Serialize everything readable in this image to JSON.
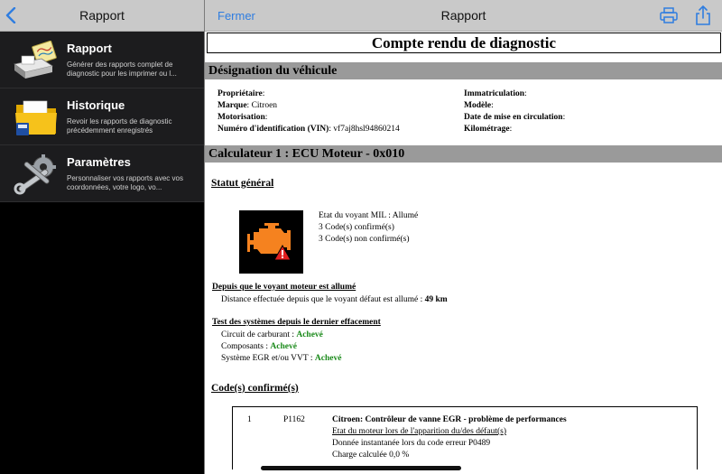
{
  "sidebar": {
    "title": "Rapport",
    "items": [
      {
        "icon": "report-printer-icon",
        "title": "Rapport",
        "description": "Générer des rapports complet de diagnostic pour les imprimer ou l..."
      },
      {
        "icon": "folder-history-icon",
        "title": "Historique",
        "description": "Revoir les rapports de diagnostic précédemment enregistrés"
      },
      {
        "icon": "tools-gear-icon",
        "title": "Paramètres",
        "description": "Personnaliser vos rapports avec vos coordonnées, votre logo, vo..."
      }
    ]
  },
  "main": {
    "close_label": "Fermer",
    "title": "Rapport"
  },
  "report": {
    "title": "Compte rendu de diagnostic",
    "vehicle_section": "Désignation du véhicule",
    "vehicle": {
      "owner_label": "Propriétaire",
      "owner_value": "",
      "brand_label": "Marque",
      "brand_value": "Citroen",
      "engine_label": "Motorisation",
      "engine_value": "",
      "vin_label": "Numéro d'identification (VIN)",
      "vin_value": "vf7aj8hsl94860214",
      "plate_label": "Immatriculation",
      "plate_value": "",
      "model_label": "Modèle",
      "model_value": "",
      "date_label": "Date de mise en circulation",
      "date_value": "",
      "mileage_label": "Kilométrage",
      "mileage_value": ""
    },
    "ecu_section": "Calculateur 1 : ECU Moteur - 0x010",
    "general_status_title": "Statut général",
    "mil": {
      "icon": "engine-warning-icon",
      "line1": "Etat du voyant MIL : Allumé",
      "line2": "3 Code(s) confirmé(s)",
      "line3": "3 Code(s) non confirmé(s)"
    },
    "mil_since_title": "Depuis que le voyant moteur est allumé",
    "mil_distance_text": "Distance effectuée depuis que le voyant défaut est allumé : ",
    "mil_distance_value": "49 km",
    "tests_title": "Test des systèmes depuis le dernier effacement",
    "tests": [
      {
        "label": "Circuit de carburant : ",
        "status": "Achevé"
      },
      {
        "label": "Composants : ",
        "status": "Achevé"
      },
      {
        "label": "Système EGR et/ou VVT : ",
        "status": "Achevé"
      }
    ],
    "status_color": "#1a8a1a",
    "confirmed_codes_title": "Code(s) confirmé(s)",
    "codes": [
      {
        "index": "1",
        "code": "P1162",
        "title": "Citroen: Contrôleur de vanne EGR - problème de performances",
        "state_link": "Etat du moteur lors de l'apparition du/des défaut(s)",
        "freeze_frame": "Donnée instantanée lors du code erreur P0489",
        "load": "Charge calculée 0,0 %"
      }
    ]
  },
  "colors": {
    "accent": "#2f7de0",
    "nav_bar": "#c9c9c9",
    "section_bar": "#9a9a9a",
    "mil_icon": "#f5821f"
  }
}
